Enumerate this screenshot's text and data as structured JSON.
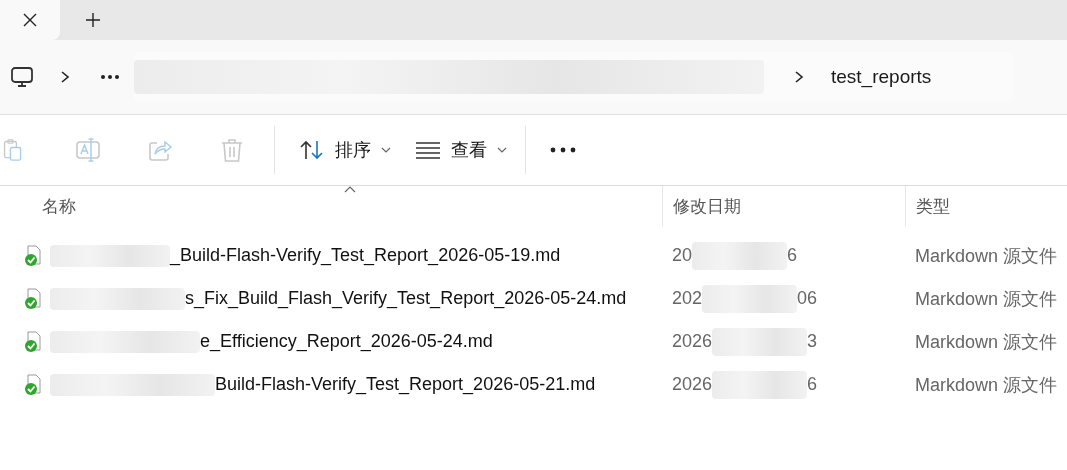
{
  "address": {
    "folder": "test_reports"
  },
  "toolbar": {
    "actions": [
      {
        "kind": "paste",
        "disabled": true
      },
      {
        "kind": "rename",
        "disabled": true
      },
      {
        "kind": "share",
        "disabled": true
      },
      {
        "kind": "delete",
        "disabled": true
      }
    ],
    "sort": {
      "label": "排序"
    },
    "view": {
      "label": "查看"
    }
  },
  "columns": [
    {
      "label": "名称",
      "sorted": true
    },
    {
      "label": "修改日期",
      "sorted": false
    },
    {
      "label": "类型",
      "sorted": false
    }
  ],
  "files": [
    {
      "name": "_Build-Flash-Verify_Test_Report_2026-05-19.md",
      "date_start": "20",
      "date_end": "6",
      "type": "Markdown 源文件",
      "synced": true
    },
    {
      "name": "s_Fix_Build_Flash_Verify_Test_Report_2026-05-24.md",
      "date_start": "202",
      "date_end": "06",
      "type": "Markdown 源文件",
      "synced": true
    },
    {
      "name": "e_Efficiency_Report_2026-05-24.md",
      "date_start": "2026",
      "date_end": "3",
      "type": "Markdown 源文件",
      "synced": true
    },
    {
      "name": "Build-Flash-Verify_Test_Report_2026-05-21.md",
      "date_start": "2026",
      "date_end": "6",
      "type": "Markdown 源文件",
      "synced": true
    }
  ]
}
